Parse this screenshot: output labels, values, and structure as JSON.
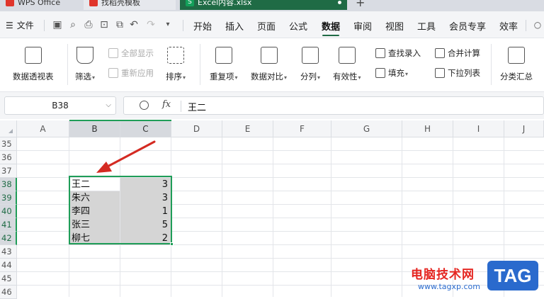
{
  "titlebar": {
    "tabs": [
      {
        "label": "WPS Office"
      },
      {
        "label": "找稻壳模板"
      },
      {
        "label": "Excel内容.xlsx"
      }
    ]
  },
  "menubar": {
    "file_label": "文件",
    "items": [
      "开始",
      "插入",
      "页面",
      "公式",
      "数据",
      "审阅",
      "视图",
      "工具",
      "会员专享",
      "效率"
    ],
    "active": "数据"
  },
  "ribbon": {
    "pivot": "数据透视表",
    "filter": "筛选",
    "show_all": "全部显示",
    "reapply": "重新应用",
    "sort": "排序",
    "duplicates": "重复项",
    "compare": "数据对比",
    "split": "分列",
    "validity": "有效性",
    "find_entry": "查找录入",
    "fill": "填充",
    "consolidate": "合并计算",
    "dropdown_list": "下拉列表",
    "subtotal": "分类汇总"
  },
  "formula_bar": {
    "name_box": "B38",
    "fx": "fx",
    "value": "王二"
  },
  "sheet": {
    "columns": [
      "A",
      "B",
      "C",
      "D",
      "E",
      "F",
      "G",
      "H",
      "I",
      "J"
    ],
    "selected_columns": [
      "B",
      "C"
    ],
    "rows": [
      "35",
      "36",
      "37",
      "38",
      "39",
      "40",
      "41",
      "42",
      "43",
      "44",
      "45",
      "46"
    ],
    "selected_rows": [
      "38",
      "39",
      "40",
      "41",
      "42"
    ],
    "data": [
      {
        "name": "王二",
        "value": "3"
      },
      {
        "name": "朱六",
        "value": "3"
      },
      {
        "name": "李四",
        "value": "1"
      },
      {
        "name": "张三",
        "value": "5"
      },
      {
        "name": "柳七",
        "value": "2"
      }
    ]
  },
  "annotation": {
    "arrow_color": "#d42a22"
  },
  "watermark": {
    "text": "电脑技术网",
    "url": "www.tagxp.com",
    "badge": "TAG"
  },
  "colors": {
    "accent": "#1f6b45",
    "selection": "#1f9d58"
  }
}
